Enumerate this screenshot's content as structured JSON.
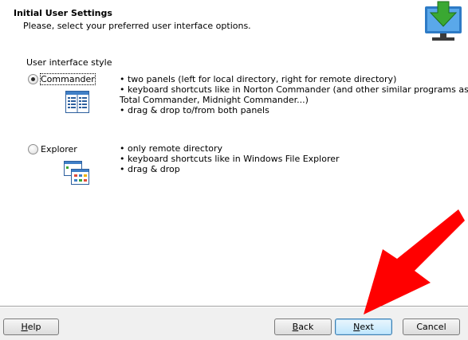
{
  "header": {
    "title": "Initial User Settings",
    "subtitle": "Please, select your preferred user interface options.",
    "icon": "download-computer-icon"
  },
  "section_label": "User interface style",
  "options": [
    {
      "label": "Commander",
      "selected": true,
      "icon": "commander-panels-icon",
      "bullets": [
        "• two panels (left for local directory, right for remote directory)",
        "• keyboard shortcuts like in Norton Commander (and other similar programs as",
        "Total Commander, Midnight Commander...)",
        "• drag & drop to/from both panels"
      ]
    },
    {
      "label": "Explorer",
      "selected": false,
      "icon": "explorer-windows-icon",
      "bullets": [
        "• only remote directory",
        "• keyboard shortcuts like in Windows File Explorer",
        "• drag & drop"
      ]
    }
  ],
  "buttons": {
    "help": "Help",
    "back": "Back",
    "next": "Next",
    "cancel": "Cancel"
  },
  "colors": {
    "accent_green": "#3aa832",
    "arrow_red": "#ff0000",
    "default_button_border": "#3c7fb1"
  }
}
